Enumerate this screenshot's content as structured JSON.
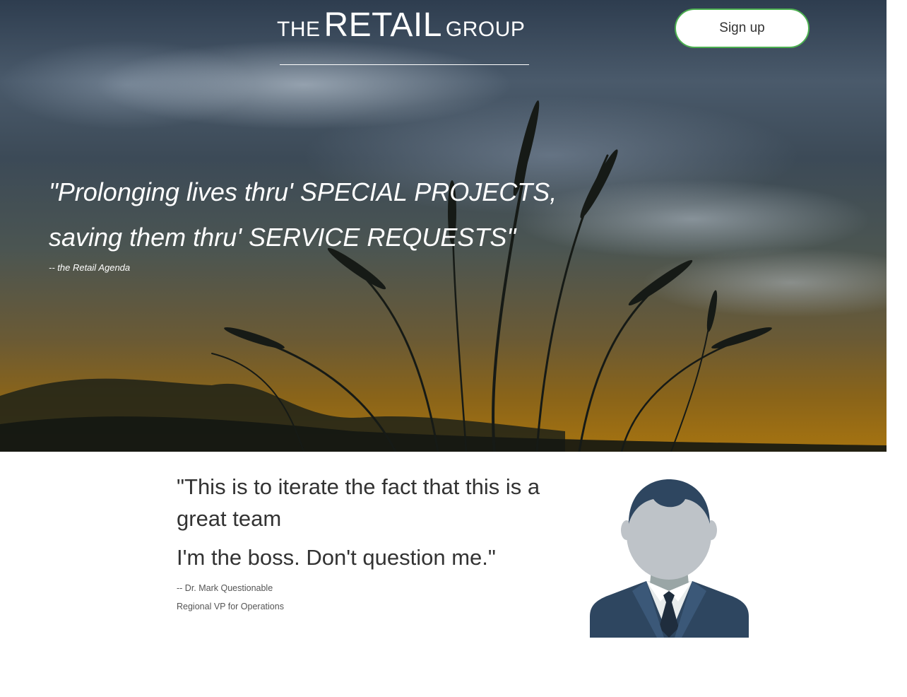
{
  "header": {
    "brand_the": "THE",
    "brand_retail": "RETAIL",
    "brand_group": "GROUP",
    "signup_label": "Sign up"
  },
  "hero": {
    "quote_line1": "\"Prolonging lives thru' SPECIAL PROJECTS,",
    "quote_line2": "saving them thru' SERVICE REQUESTS\"",
    "attribution": "-- the Retail Agenda"
  },
  "testimonial": {
    "quote_line1": "\"This is to iterate the fact that this is a great team",
    "quote_line2": "I'm the boss. Don't question me.\"",
    "author": "-- Dr. Mark Questionable",
    "role": "Regional VP for Operations"
  },
  "colors": {
    "accent_border": "#4caf50",
    "text_dark": "#333333",
    "avatar_navy": "#2e4660"
  },
  "icons": {
    "avatar": "businessman-avatar-icon"
  }
}
